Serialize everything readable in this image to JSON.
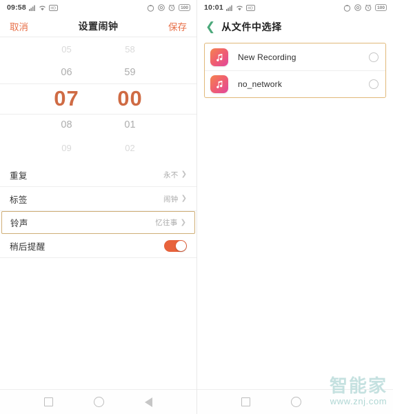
{
  "colors": {
    "accent_orange": "#e8714a",
    "selected_time": "#cf6b44",
    "toggle_on": "#e8633c",
    "highlight_border": "#cfae76",
    "file_box_border": "#e0b878",
    "back_chevron_green": "#4ba87a",
    "watermark": "#bfdedd"
  },
  "left_screen": {
    "status_bar": {
      "time": "09:58",
      "left_icons": [
        "signal-icon",
        "wifi-icon",
        "hd-icon"
      ],
      "right_icons": [
        "data-saver-icon",
        "do-not-disturb-icon",
        "alarm-icon"
      ],
      "battery_level": "100"
    },
    "header": {
      "cancel_label": "取消",
      "title": "设置闹钟",
      "save_label": "保存"
    },
    "time_picker": {
      "hours": {
        "far_above": "05",
        "near_above": "06",
        "selected": "07",
        "near_below": "08",
        "far_below": "09"
      },
      "minutes": {
        "far_above": "58",
        "near_above": "59",
        "selected": "00",
        "near_below": "01",
        "far_below": "02"
      }
    },
    "settings": [
      {
        "label": "重复",
        "value": "永不",
        "type": "chevron",
        "highlighted": false
      },
      {
        "label": "标签",
        "value": "闹钟",
        "type": "chevron",
        "highlighted": false
      },
      {
        "label": "铃声",
        "value": "忆往事",
        "type": "chevron",
        "highlighted": true
      },
      {
        "label": "稍后提醒",
        "value": "",
        "type": "toggle",
        "toggle_on": true,
        "highlighted": false
      }
    ],
    "navbar": {
      "recents": "recents-square-icon",
      "home": "home-circle-icon",
      "back": "back-triangle-icon"
    }
  },
  "right_screen": {
    "status_bar": {
      "time": "10:01",
      "left_icons": [
        "signal-icon",
        "wifi-icon",
        "hd-icon"
      ],
      "right_icons": [
        "data-saver-icon",
        "do-not-disturb-icon",
        "alarm-icon"
      ],
      "battery_level": "100"
    },
    "header": {
      "back_icon": "back-chevron-icon",
      "title": "从文件中选择"
    },
    "files": [
      {
        "name": "New Recording",
        "icon": "music-note-icon",
        "selected": false
      },
      {
        "name": "no_network",
        "icon": "music-note-icon",
        "selected": false
      }
    ],
    "navbar": {
      "recents": "recents-square-icon",
      "home": "home-circle-icon"
    }
  },
  "watermark": {
    "brand": "智能家",
    "url": "www.znj.com"
  }
}
